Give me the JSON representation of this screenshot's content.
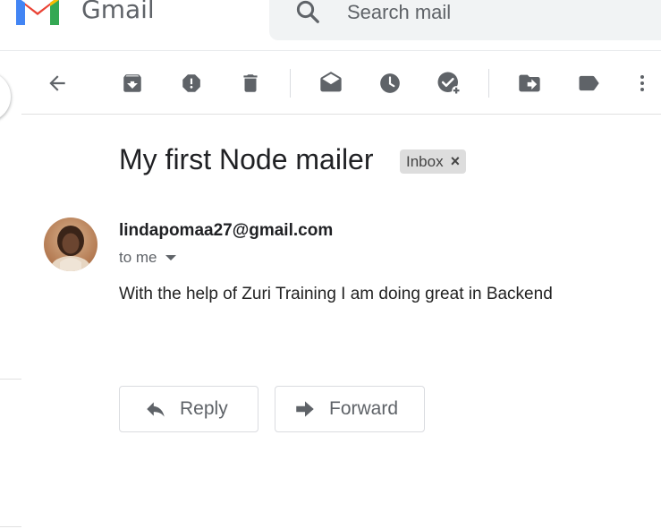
{
  "app": {
    "brand": "Gmail"
  },
  "search": {
    "placeholder": "Search mail"
  },
  "toolbar": {
    "icons": [
      "back-arrow-icon",
      "archive-icon",
      "report-spam-icon",
      "delete-icon",
      "mark-unread-icon",
      "snooze-icon",
      "add-to-tasks-icon",
      "move-to-icon",
      "labels-icon",
      "more-options-icon"
    ]
  },
  "email": {
    "subject": "My first Node mailer",
    "label": "Inbox",
    "label_remove": "×",
    "sender": "lindapomaa27@gmail.com",
    "recipient": "to me",
    "body": "With the help of Zuri Training I am doing great in Backend"
  },
  "actions": {
    "reply": "Reply",
    "forward": "Forward"
  },
  "colors": {
    "gmail_red": "#EA4335",
    "gmail_blue": "#4285F4",
    "gmail_green": "#34A853",
    "gmail_yellow": "#FBBC04",
    "icon_gray": "#5f6368"
  }
}
